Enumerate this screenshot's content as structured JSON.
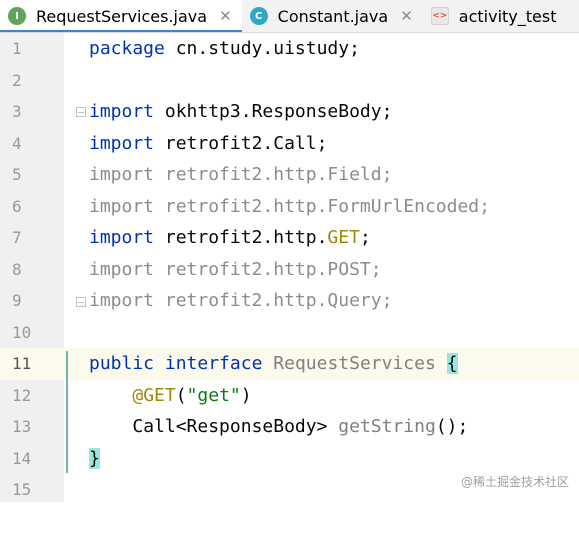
{
  "tabs": [
    {
      "label": "RequestServices.java",
      "icon": "interface-icon",
      "icon_letter": "I",
      "icon_color": "#5ea35e",
      "active": true
    },
    {
      "label": "Constant.java",
      "icon": "class-icon",
      "icon_letter": "C",
      "icon_color": "#2fa9c5",
      "active": false
    },
    {
      "label": "activity_test",
      "icon": "layout-xml-icon",
      "icon_letter": "<>",
      "icon_color": "#e0582b",
      "active": false
    }
  ],
  "close_glyph": "✕",
  "line_numbers": [
    "1",
    "2",
    "3",
    "4",
    "5",
    "6",
    "7",
    "8",
    "9",
    "10",
    "11",
    "12",
    "13",
    "14",
    "15"
  ],
  "current_line": "11",
  "code": {
    "l1": {
      "kw": "package",
      "rest": " cn.study.uistudy;"
    },
    "l3": {
      "kw": "import",
      "rest": " okhttp3.ResponseBody;"
    },
    "l4": {
      "kw": "import",
      "rest": " retrofit2.Call;"
    },
    "l5": {
      "text": "import retrofit2.http.Field;"
    },
    "l6": {
      "text": "import retrofit2.http.FormUrlEncoded;"
    },
    "l7": {
      "kw": "import",
      "rest_a": " retrofit2.http.",
      "ann": "GET",
      "rest_b": ";"
    },
    "l8": {
      "text": "import retrofit2.http.POST;"
    },
    "l9": {
      "text": "import retrofit2.http.Query;"
    },
    "l11": {
      "kw1": "public",
      "kw2": "interface",
      "name": "RequestServices",
      "brace": "{"
    },
    "l12": {
      "ann": "@GET",
      "open": "(",
      "str": "\"get\"",
      "close": ")"
    },
    "l13": {
      "type": "Call<ResponseBody>",
      "method": "getString",
      "rest": "();"
    },
    "l14": {
      "brace": "}"
    }
  },
  "watermark": "@稀土掘金技术社区"
}
